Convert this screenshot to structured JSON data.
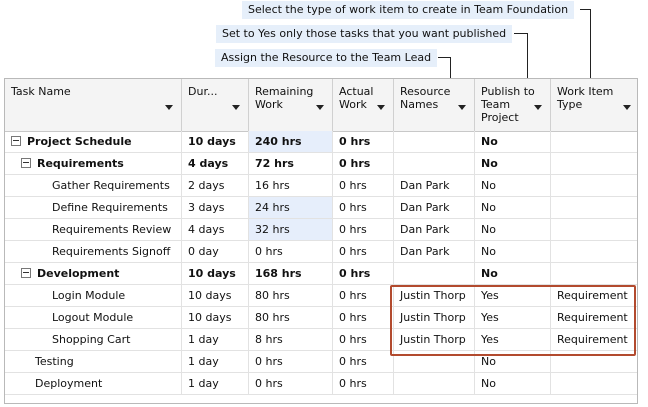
{
  "callouts": {
    "work_item_type": "Select the type of work item to create in Team Foundation",
    "publish": "Set to Yes only those tasks that you want published",
    "resource": "Assign the Resource to the Team Lead"
  },
  "columns": [
    {
      "label": "Task Name"
    },
    {
      "label": "Dur..."
    },
    {
      "label": "Remaining Work"
    },
    {
      "label": "Actual Work"
    },
    {
      "label": "Resource Names"
    },
    {
      "label": "Publish to Team Project"
    },
    {
      "label": "Work Item Type"
    }
  ],
  "rows": [
    {
      "task": "Project Schedule",
      "duration": "10 days",
      "remaining": "240 hrs",
      "actual": "0 hrs",
      "resource": "",
      "publish": "No",
      "type": ""
    },
    {
      "task": "Requirements",
      "duration": "4 days",
      "remaining": "72 hrs",
      "actual": "0 hrs",
      "resource": "",
      "publish": "No",
      "type": ""
    },
    {
      "task": "Gather Requirements",
      "duration": "2 days",
      "remaining": "16 hrs",
      "actual": "0 hrs",
      "resource": "Dan Park",
      "publish": "No",
      "type": ""
    },
    {
      "task": "Define Requirements",
      "duration": "3 days",
      "remaining": "24 hrs",
      "actual": "0 hrs",
      "resource": "Dan Park",
      "publish": "No",
      "type": ""
    },
    {
      "task": "Requirements Review",
      "duration": "4 days",
      "remaining": "32 hrs",
      "actual": "0 hrs",
      "resource": "Dan Park",
      "publish": "No",
      "type": ""
    },
    {
      "task": "Requirements Signoff",
      "duration": "0 day",
      "remaining": "0 hrs",
      "actual": "0 hrs",
      "resource": "Dan Park",
      "publish": "No",
      "type": ""
    },
    {
      "task": "Development",
      "duration": "10 days",
      "remaining": "168 hrs",
      "actual": "0 hrs",
      "resource": "",
      "publish": "No",
      "type": ""
    },
    {
      "task": "Login Module",
      "duration": "10 days",
      "remaining": "80 hrs",
      "actual": "0 hrs",
      "resource": "Justin Thorp",
      "publish": "Yes",
      "type": "Requirement"
    },
    {
      "task": "Logout Module",
      "duration": "10 days",
      "remaining": "80 hrs",
      "actual": "0 hrs",
      "resource": "Justin Thorp",
      "publish": "Yes",
      "type": "Requirement"
    },
    {
      "task": "Shopping Cart",
      "duration": "1 day",
      "remaining": "8 hrs",
      "actual": "0 hrs",
      "resource": "Justin Thorp",
      "publish": "Yes",
      "type": "Requirement"
    },
    {
      "task": "Testing",
      "duration": "1 day",
      "remaining": "0 hrs",
      "actual": "0 hrs",
      "resource": "",
      "publish": "No",
      "type": ""
    },
    {
      "task": "Deployment",
      "duration": "1 day",
      "remaining": "0 hrs",
      "actual": "0 hrs",
      "resource": "",
      "publish": "No",
      "type": ""
    }
  ],
  "colors": {
    "callout_bg": "#e6effa",
    "highlight_bg": "#e6eefb",
    "redbox_border": "#b24a2e"
  }
}
